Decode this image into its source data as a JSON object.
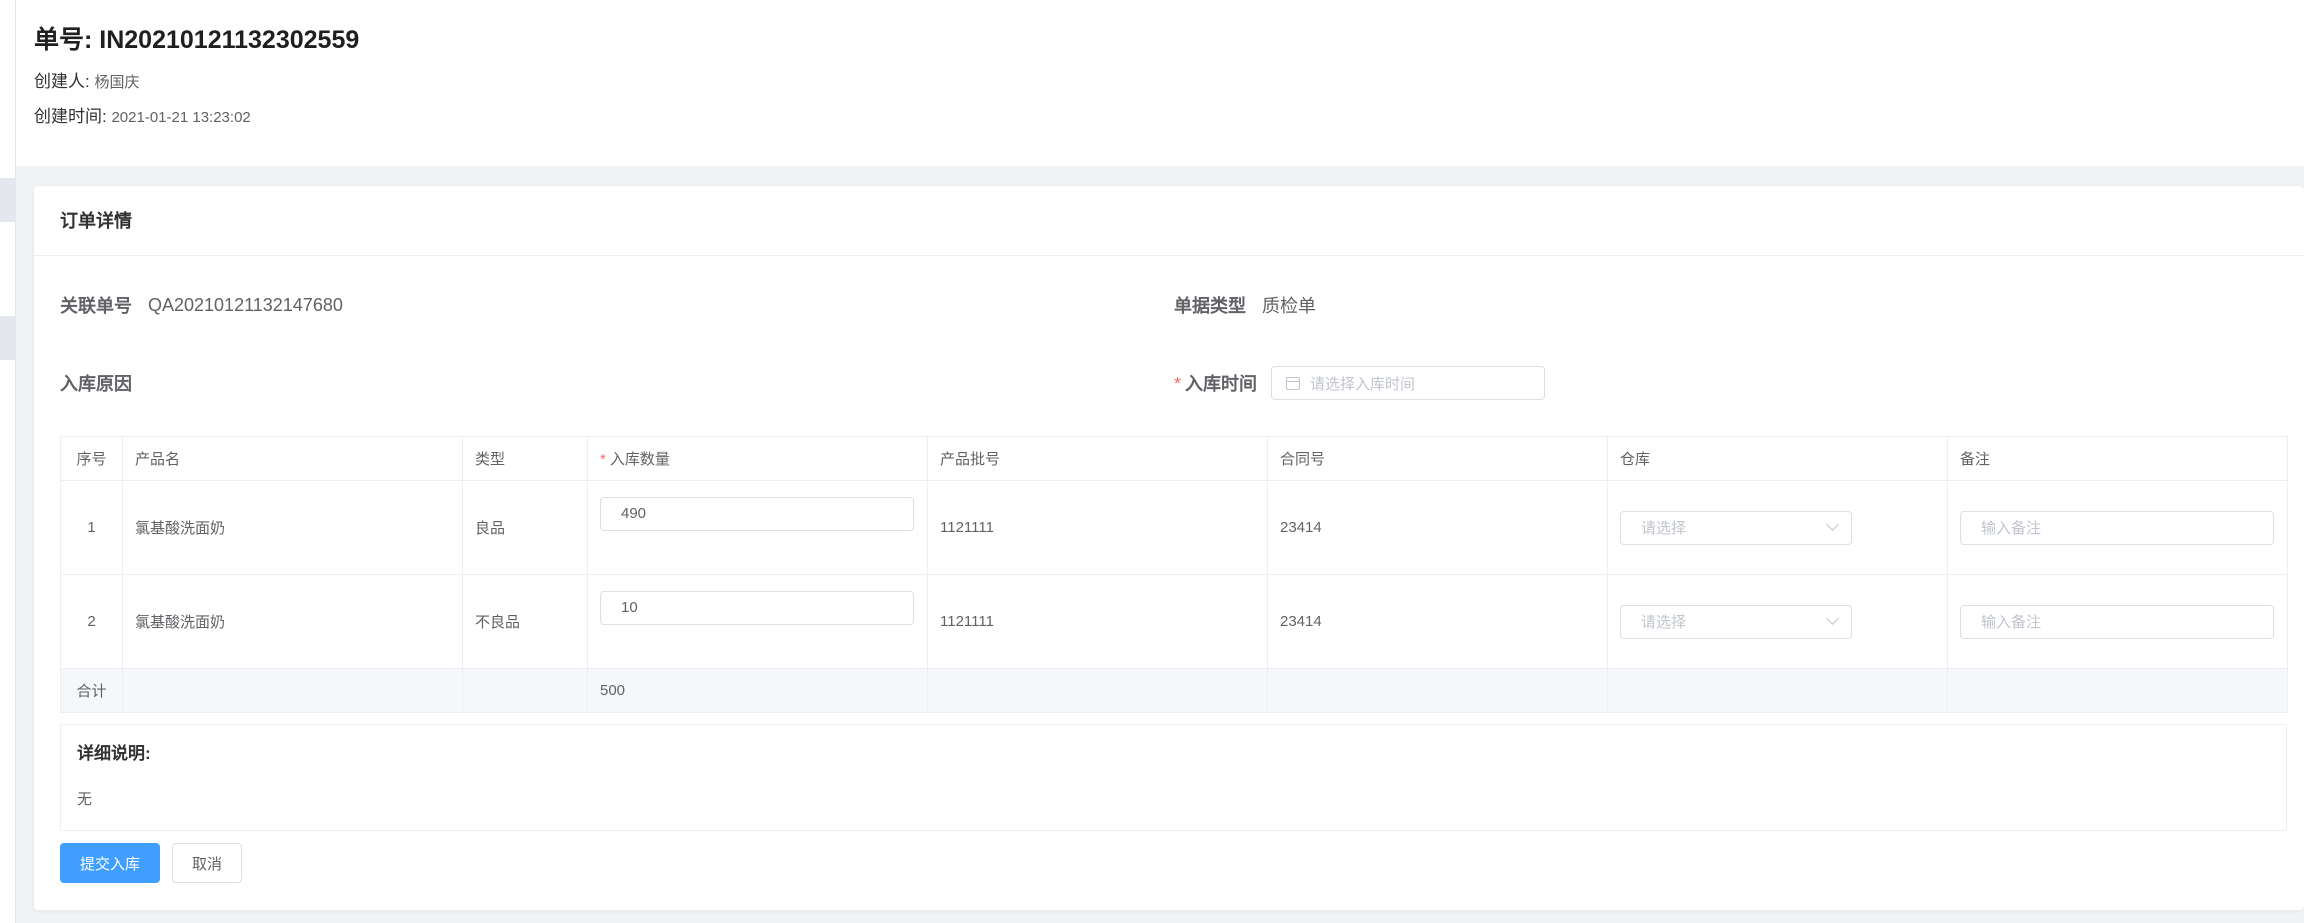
{
  "header": {
    "order_no": "单号: IN20210121132302559",
    "creator_label": "创建人:",
    "creator": "杨国庆",
    "created_label": "创建时间:",
    "created_at": "2021-01-21 13:23:02"
  },
  "card": {
    "title": "订单详情",
    "related_no_label": "关联单号",
    "related_no": "QA20210121132147680",
    "doc_type_label": "单据类型",
    "doc_type": "质检单",
    "reason_label": "入库原因",
    "time_required_mark": "*",
    "time_label": "入库时间",
    "time_placeholder": "请选择入库时间"
  },
  "table": {
    "columns": [
      "序号",
      "产品名",
      "类型",
      "入库数量",
      "产品批号",
      "合同号",
      "仓库",
      "备注"
    ],
    "required_mark": "*",
    "rows": [
      {
        "index": "1",
        "product": "氯基酸洗面奶",
        "type": "良品",
        "qty": "490",
        "batch": "1121111",
        "contract": "23414",
        "warehouse_placeholder": "请选择",
        "remark_placeholder": "输入备注"
      },
      {
        "index": "2",
        "product": "氯基酸洗面奶",
        "type": "不良品",
        "qty": "10",
        "batch": "1121111",
        "contract": "23414",
        "warehouse_placeholder": "请选择",
        "remark_placeholder": "输入备注"
      }
    ],
    "summary": {
      "label": "合计",
      "qty_total": "500"
    }
  },
  "description": {
    "title": "详细说明:",
    "value": "无"
  },
  "buttons": {
    "submit": "提交入库",
    "cancel": "取消"
  },
  "colors": {
    "primary": "#409eff",
    "required": "#f56c6c"
  }
}
